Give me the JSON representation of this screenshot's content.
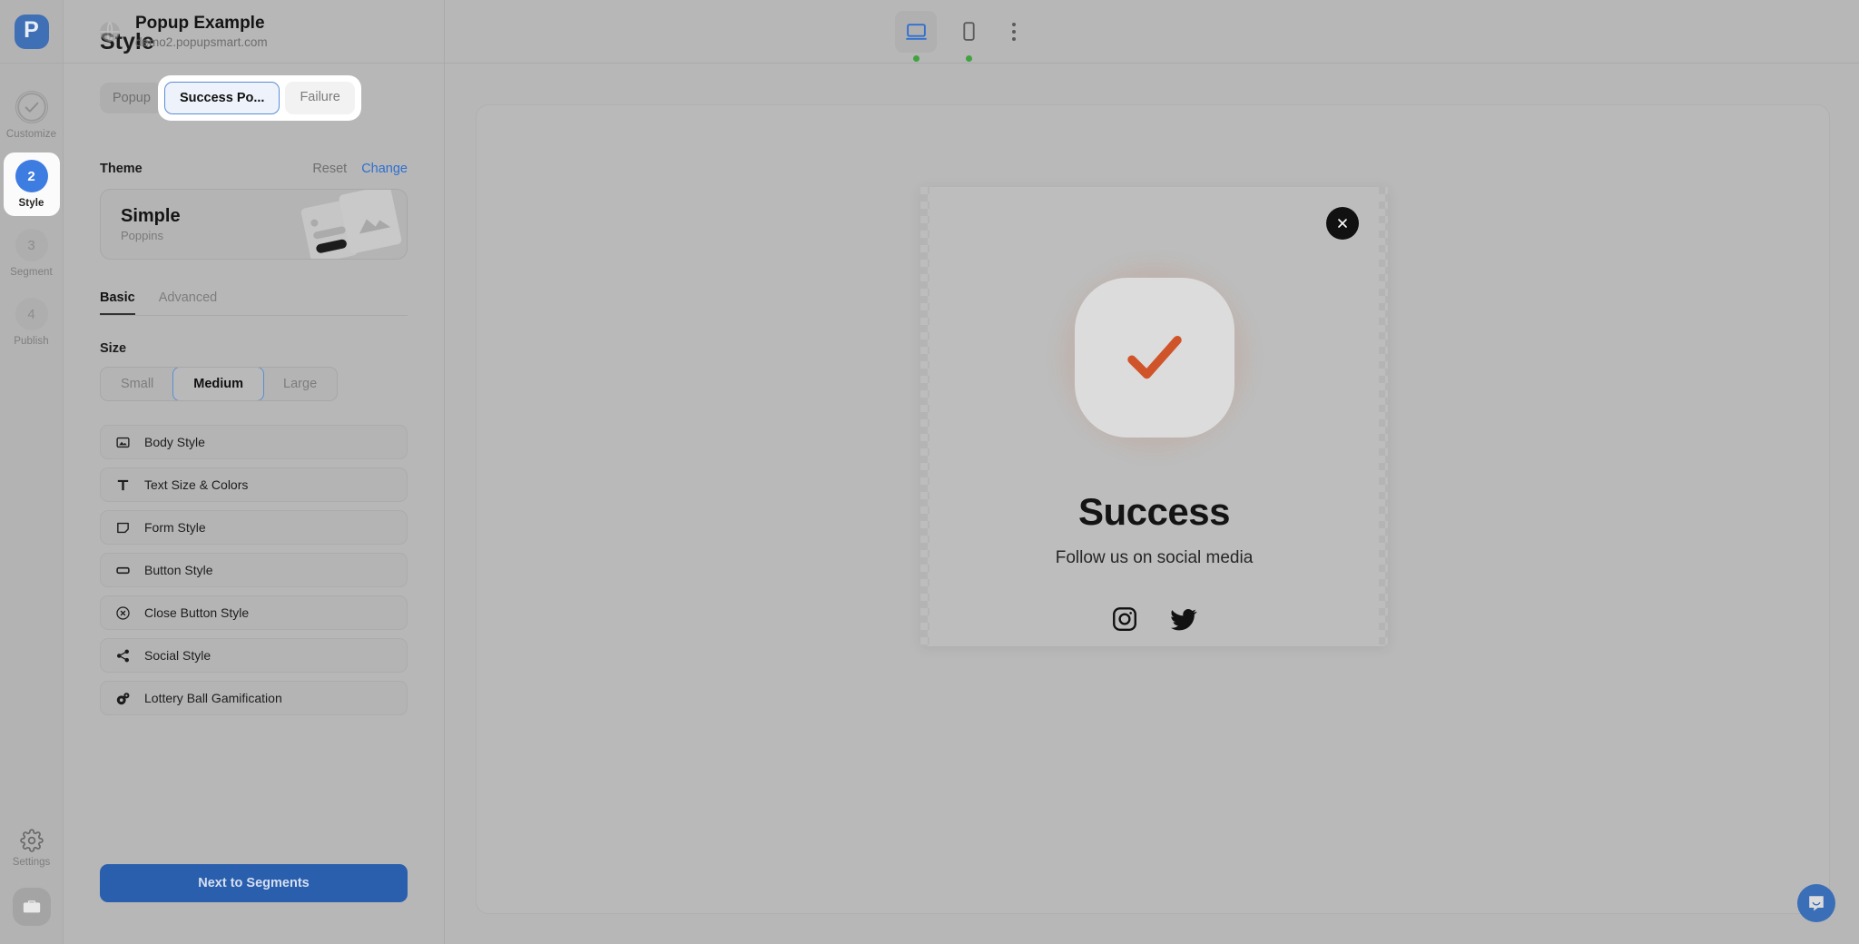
{
  "brand": {
    "logo_letter": "P",
    "accent_blue": "#3d7ce0",
    "primary_button": "#2a5fae"
  },
  "rail": {
    "steps": [
      {
        "badge": "✓",
        "label": "Customize",
        "state": "done"
      },
      {
        "badge": "2",
        "label": "Style",
        "state": "active"
      },
      {
        "badge": "3",
        "label": "Segment",
        "state": "idle"
      },
      {
        "badge": "4",
        "label": "Publish",
        "state": "idle"
      }
    ],
    "settings_label": "Settings",
    "briefcase_icon": "briefcase-icon"
  },
  "topbar": {
    "site_name": "Popup Example",
    "site_url": "demo2.popupsmart.com",
    "globe_icon": "globe-icon",
    "devices": [
      {
        "name": "desktop",
        "icon": "desktop-icon",
        "active": true,
        "status": "online"
      },
      {
        "name": "mobile",
        "icon": "mobile-icon",
        "active": false,
        "status": "online"
      }
    ],
    "more_icon": "kebab-menu-icon"
  },
  "panel": {
    "title": "Style",
    "tabs": [
      {
        "label": "Popup",
        "active": false,
        "outside": true
      },
      {
        "label": "Success Po...",
        "active": true,
        "outside": false
      },
      {
        "label": "Failure",
        "active": false,
        "outside": false
      }
    ],
    "theme": {
      "section_label": "Theme",
      "reset_label": "Reset",
      "change_label": "Change",
      "name": "Simple",
      "font": "Poppins"
    },
    "subtabs": [
      {
        "label": "Basic",
        "active": true
      },
      {
        "label": "Advanced",
        "active": false
      }
    ],
    "size": {
      "label": "Size",
      "options": [
        {
          "label": "Small",
          "active": false
        },
        {
          "label": "Medium",
          "active": true
        },
        {
          "label": "Large",
          "active": false
        }
      ]
    },
    "options": [
      {
        "label": "Body Style",
        "icon": "image-icon"
      },
      {
        "label": "Text Size & Colors",
        "icon": "text-icon"
      },
      {
        "label": "Form Style",
        "icon": "form-icon"
      },
      {
        "label": "Button Style",
        "icon": "button-icon"
      },
      {
        "label": "Close Button Style",
        "icon": "close-circle-icon"
      },
      {
        "label": "Social Style",
        "icon": "share-icon"
      },
      {
        "label": "Lottery Ball Gamification",
        "icon": "lottery-ball-icon"
      }
    ],
    "next_button": "Next to Segments"
  },
  "preview": {
    "close_icon": "close-icon",
    "check_icon": "check-icon",
    "check_color": "#d0542a",
    "title": "Success",
    "subtitle": "Follow us on social media",
    "socials": [
      {
        "name": "instagram",
        "icon": "instagram-icon"
      },
      {
        "name": "twitter",
        "icon": "twitter-icon"
      }
    ]
  },
  "chat": {
    "icon": "chat-bubble-icon"
  }
}
